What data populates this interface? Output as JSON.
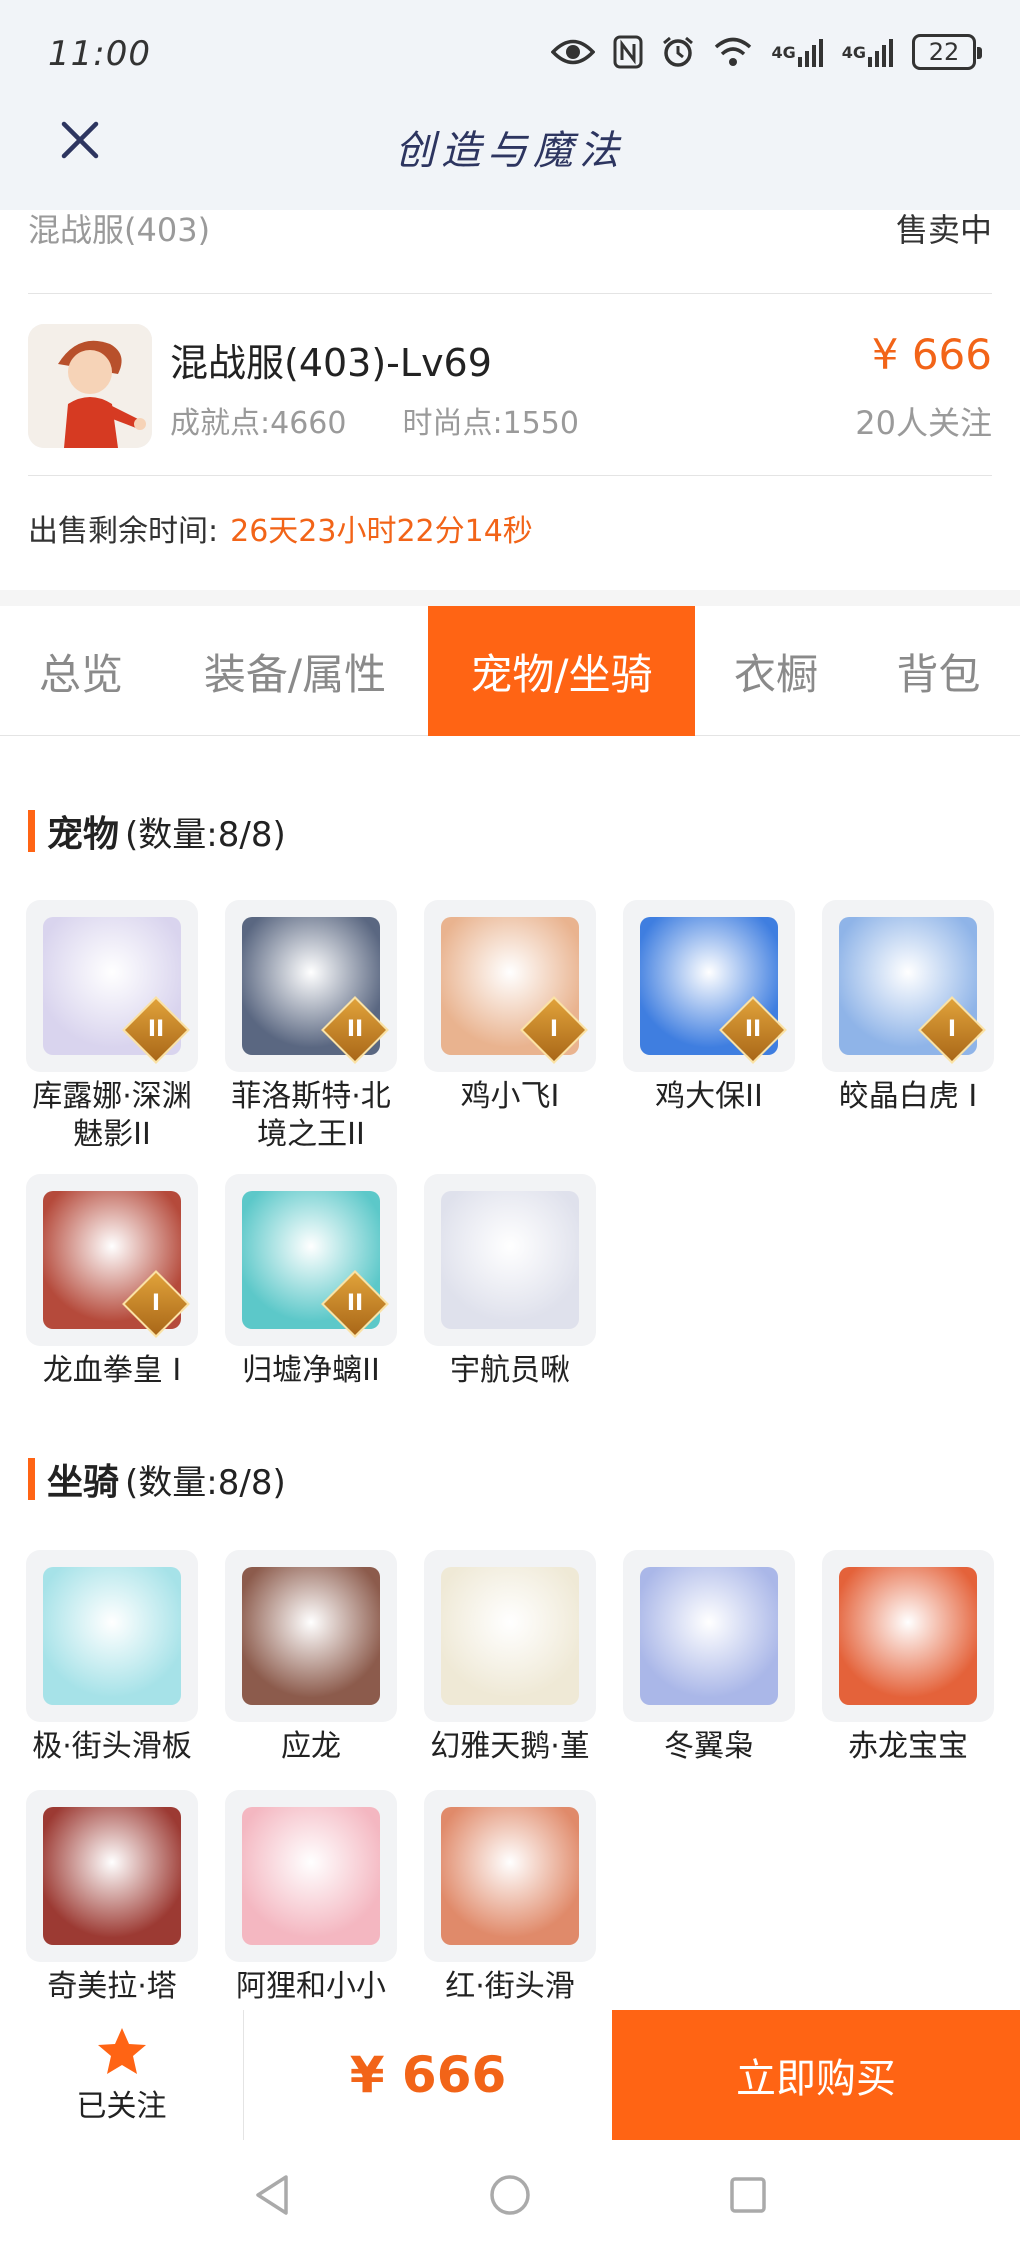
{
  "status_bar": {
    "time": "11:00",
    "battery": "22",
    "signal_1": "4G",
    "signal_2": "4G"
  },
  "header": {
    "title": "创造与魔法"
  },
  "listing": {
    "server": "混战服(403)",
    "status": "售卖中",
    "char_name": "混战服(403)-Lv69",
    "achievement": "成就点:4660",
    "fashion": "时尚点:1550",
    "price": "¥ 666",
    "watchers": "20人关注",
    "remaining_label": "出售剩余时间:",
    "remaining_value": "26天23小时22分14秒"
  },
  "tabs": [
    {
      "label": "总览",
      "active": false
    },
    {
      "label": "装备/属性",
      "active": false
    },
    {
      "label": "宠物/坐骑",
      "active": true
    },
    {
      "label": "衣橱",
      "active": false
    },
    {
      "label": "背包",
      "active": false
    }
  ],
  "pets": {
    "title": "宠物",
    "count": "(数量:8/8)",
    "items": [
      {
        "name": "库露娜·深渊魅影II",
        "badge": "II",
        "color": "#d9d4ee"
      },
      {
        "name": "菲洛斯特·北境之王II",
        "badge": "II",
        "color": "#5a6781"
      },
      {
        "name": "鸡小飞I",
        "badge": "I",
        "color": "#e9b38f"
      },
      {
        "name": "鸡大保II",
        "badge": "II",
        "color": "#3f7ee0"
      },
      {
        "name": "皎晶白虎 I",
        "badge": "I",
        "color": "#8fb4e8"
      },
      {
        "name": "龙血拳皇 I",
        "badge": "I",
        "color": "#b54a3b"
      },
      {
        "name": "归墟净螭II",
        "badge": "II",
        "color": "#5cc8c9"
      },
      {
        "name": "宇航员啾",
        "badge": "",
        "color": "#dfe1ec"
      }
    ]
  },
  "mounts": {
    "title": "坐骑",
    "count": "(数量:8/8)",
    "items": [
      {
        "name": "极·街头滑板",
        "color": "#a6e2e8"
      },
      {
        "name": "应龙",
        "color": "#8c5b4c"
      },
      {
        "name": "幻雅天鹅·堇",
        "color": "#efe9d6"
      },
      {
        "name": "冬翼枭",
        "color": "#aab7e8"
      },
      {
        "name": "赤龙宝宝",
        "color": "#e4623a"
      },
      {
        "name": "奇美拉·塔",
        "color": "#9c3a33"
      },
      {
        "name": "阿狸和小小",
        "color": "#f4b7c1"
      },
      {
        "name": "红·街头滑",
        "color": "#e08a6a"
      }
    ]
  },
  "bottom": {
    "follow_label": "已关注",
    "price": "¥ 666",
    "buy_label": "立即购买"
  },
  "colors": {
    "accent": "#ff6414",
    "price": "#f26418"
  }
}
